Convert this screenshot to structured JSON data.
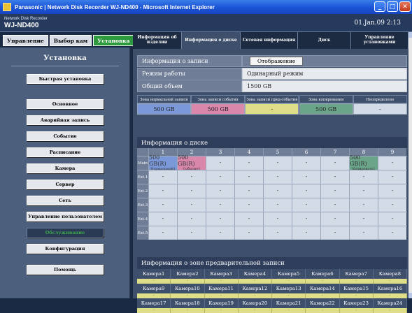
{
  "window": {
    "title": "Panasonic | Network Disk Recorder WJ-ND400 - Microsoft Internet Explorer"
  },
  "header": {
    "brand_small": "Network Disk Recorder",
    "brand_model": "WJ-ND400",
    "datetime": "01.Jan.09  2:13"
  },
  "topnav": [
    {
      "label": "Управление",
      "active": false
    },
    {
      "label": "Выбор кам",
      "active": false
    },
    {
      "label": "Установка",
      "active": true
    }
  ],
  "sidebar": {
    "title": "Установка",
    "items": [
      "Быстрая установка",
      "Основное",
      "Аварийная запись",
      "Событие",
      "Расписание",
      "Камера",
      "Сервер",
      "Сеть",
      "Управление пользователем",
      "Обслуживание",
      "Конфигурация",
      "Помощь"
    ]
  },
  "tabs": [
    "Информация об изделии",
    "Информация о диске",
    "Сетевая информация",
    "Диск",
    "Управление установками"
  ],
  "info": {
    "rec_label": "Информация о записи",
    "rec_button": "Отображение",
    "mode_label": "Режим работы",
    "mode_value": "Одинарный режим",
    "total_label": "Общий объем",
    "total_value": "1500 GB"
  },
  "zones": [
    {
      "header": "Зона нормальной записи",
      "value": "500 GB",
      "color": "#7b98d8"
    },
    {
      "header": "Зона записи события",
      "value": "500 GB",
      "color": "#d988ac"
    },
    {
      "header": "Зона записи пред-события",
      "value": "-",
      "color": "#dedd88"
    },
    {
      "header": "Зона копирования",
      "value": "500 GB",
      "color": "#6aa58a"
    },
    {
      "header": "Неопределено",
      "value": "-",
      "color": "#d3dbe6"
    }
  ],
  "disk": {
    "title": "Информация о диске",
    "columns": [
      "1",
      "2",
      "3",
      "4",
      "5",
      "6",
      "7",
      "8",
      "9"
    ],
    "rows": [
      {
        "label": "Main",
        "cells": [
          {
            "v": "500 GB(R)",
            "s": "Нормальный1",
            "c": "blue"
          },
          {
            "v": "500 GB(R)",
            "s": "Событие1",
            "c": "pink"
          },
          {
            "v": "-"
          },
          {
            "v": "-"
          },
          {
            "v": "-"
          },
          {
            "v": "-"
          },
          {
            "v": "-"
          },
          {
            "v": "500 GB(R)",
            "s": "Копировать1",
            "c": "teal"
          },
          {
            "v": "-"
          }
        ]
      },
      {
        "label": "Ext.1",
        "cells": [
          {
            "v": "-"
          },
          {
            "v": "-"
          },
          {
            "v": "-"
          },
          {
            "v": "-"
          },
          {
            "v": "-"
          },
          {
            "v": "-"
          },
          {
            "v": "-"
          },
          {
            "v": "-"
          },
          {
            "v": "-"
          }
        ]
      },
      {
        "label": "Ext.2",
        "cells": [
          {
            "v": "-"
          },
          {
            "v": "-"
          },
          {
            "v": "-"
          },
          {
            "v": "-"
          },
          {
            "v": "-"
          },
          {
            "v": "-"
          },
          {
            "v": "-"
          },
          {
            "v": "-"
          },
          {
            "v": "-"
          }
        ]
      },
      {
        "label": "Ext.3",
        "cells": [
          {
            "v": "-"
          },
          {
            "v": "-"
          },
          {
            "v": "-"
          },
          {
            "v": "-"
          },
          {
            "v": "-"
          },
          {
            "v": "-"
          },
          {
            "v": "-"
          },
          {
            "v": "-"
          },
          {
            "v": "-"
          }
        ]
      },
      {
        "label": "Ext.4",
        "cells": [
          {
            "v": "-"
          },
          {
            "v": "-"
          },
          {
            "v": "-"
          },
          {
            "v": "-"
          },
          {
            "v": "-"
          },
          {
            "v": "-"
          },
          {
            "v": "-"
          },
          {
            "v": "-"
          },
          {
            "v": "-"
          }
        ]
      },
      {
        "label": "Ext.5",
        "cells": [
          {
            "v": "-"
          },
          {
            "v": "-"
          },
          {
            "v": "-"
          },
          {
            "v": "-"
          },
          {
            "v": "-"
          },
          {
            "v": "-"
          },
          {
            "v": "-"
          },
          {
            "v": "-"
          },
          {
            "v": "-"
          }
        ]
      }
    ]
  },
  "prerecord": {
    "title": "Информация о зоне предварительной записи",
    "rows": [
      [
        "Камера1",
        "Камера2",
        "Камера3",
        "Камера4",
        "Камера5",
        "Камера6",
        "Камера7",
        "Камера8"
      ],
      [
        "Камера9",
        "Камера10",
        "Камера11",
        "Камера12",
        "Камера13",
        "Камера14",
        "Камера15",
        "Камера16"
      ],
      [
        "Камера17",
        "Камера18",
        "Камера19",
        "Камера20",
        "Камера21",
        "Камера22",
        "Камера23",
        "Камера24"
      ]
    ],
    "value": "-"
  }
}
